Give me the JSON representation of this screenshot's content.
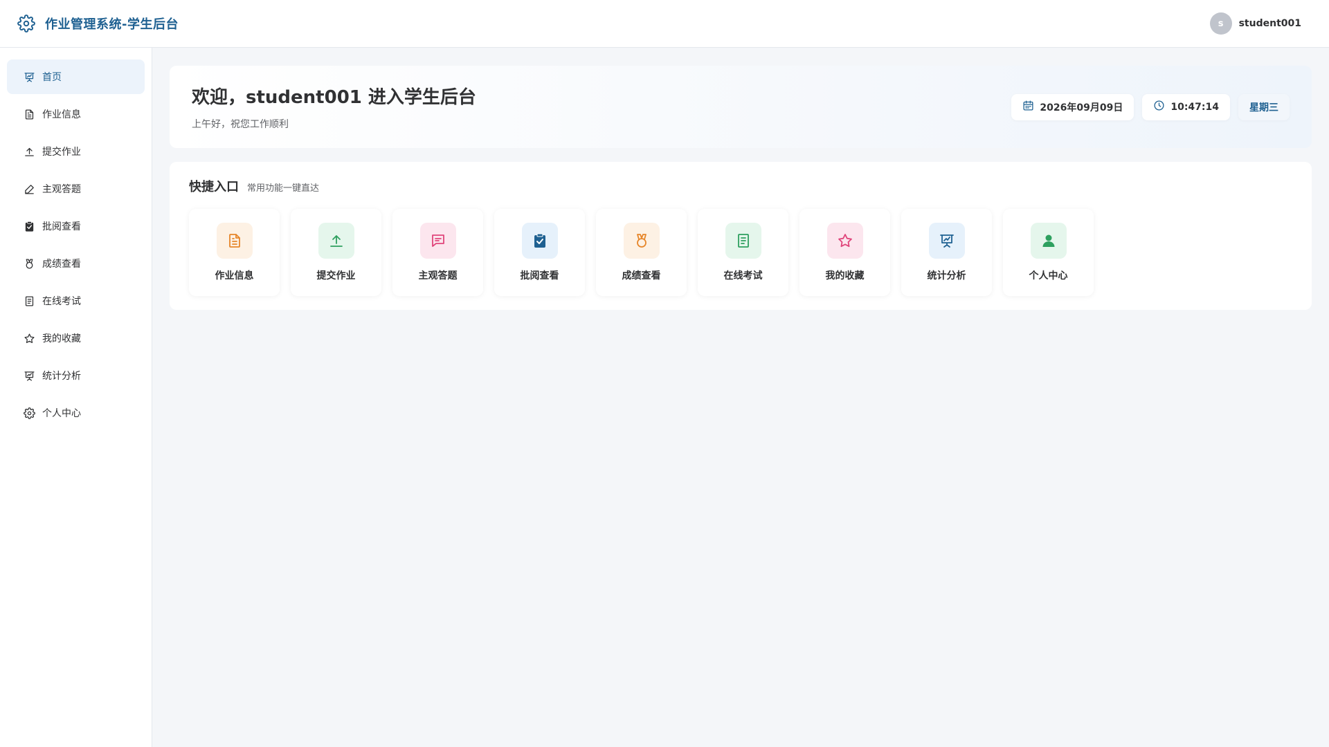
{
  "header": {
    "title": "作业管理系统-学生后台",
    "avatar_letter": "s",
    "username": "student001",
    "accent": "#1e6091"
  },
  "sidebar": {
    "items": [
      {
        "label": "首页",
        "icon": "presentation-chart-icon",
        "active": true
      },
      {
        "label": "作业信息",
        "icon": "document-icon"
      },
      {
        "label": "提交作业",
        "icon": "upload-icon"
      },
      {
        "label": "主观答题",
        "icon": "edit-pen-icon"
      },
      {
        "label": "批阅查看",
        "icon": "clipboard-check-icon"
      },
      {
        "label": "成绩查看",
        "icon": "medal-icon"
      },
      {
        "label": "在线考试",
        "icon": "notebook-icon"
      },
      {
        "label": "我的收藏",
        "icon": "star-icon"
      },
      {
        "label": "统计分析",
        "icon": "presentation-chart-icon"
      },
      {
        "label": "个人中心",
        "icon": "gear-icon"
      }
    ]
  },
  "welcome": {
    "title": "欢迎，student001 进入学生后台",
    "subtitle": "上午好，祝您工作顺利",
    "date": "2026年09月09日",
    "time": "10:47:14",
    "weekday": "星期三"
  },
  "quick": {
    "title": "快捷入口",
    "subtitle": "常用功能一键直达",
    "cards": [
      {
        "label": "作业信息",
        "icon": "document-icon",
        "bg": "#fdf1e4",
        "fg": "#e6862a"
      },
      {
        "label": "提交作业",
        "icon": "upload-icon",
        "bg": "#e5f6ec",
        "fg": "#2ea05f"
      },
      {
        "label": "主观答题",
        "icon": "chat-icon",
        "bg": "#fce6ee",
        "fg": "#e0457b"
      },
      {
        "label": "批阅查看",
        "icon": "clipboard-check-icon",
        "bg": "#e6f1fb",
        "fg": "#1e6091"
      },
      {
        "label": "成绩查看",
        "icon": "medal-icon",
        "bg": "#fdf1e4",
        "fg": "#e6862a"
      },
      {
        "label": "在线考试",
        "icon": "notebook-icon",
        "bg": "#e5f6ec",
        "fg": "#2ea05f"
      },
      {
        "label": "我的收藏",
        "icon": "star-icon",
        "bg": "#fce6ee",
        "fg": "#e0457b"
      },
      {
        "label": "统计分析",
        "icon": "presentation-chart-icon",
        "bg": "#e6f1fb",
        "fg": "#1e6091"
      },
      {
        "label": "个人中心",
        "icon": "user-icon",
        "bg": "#e5f6ec",
        "fg": "#2ea05f"
      }
    ]
  }
}
